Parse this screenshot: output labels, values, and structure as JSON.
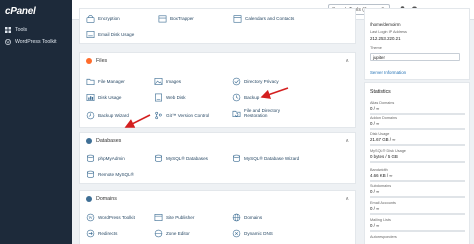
{
  "brand": "cPanel",
  "colors": {
    "sidebar": "#1d2a3a",
    "accent": "#ff6c2c",
    "link": "#1f6fb4",
    "arrow": "#d41f1f"
  },
  "sidebar": {
    "items": [
      {
        "label": "Tools",
        "icon": "grid-icon"
      },
      {
        "label": "WordPress Toolkit",
        "icon": "wordpress-icon"
      }
    ]
  },
  "topbar": {
    "search_placeholder": "Search Tools (/)"
  },
  "top_items": [
    {
      "label": "Encryption",
      "icon": "lock-icon"
    },
    {
      "label": "BoxTrapper",
      "icon": "box-icon"
    },
    {
      "label": "Calendars and Contacts",
      "icon": "calendar-icon"
    },
    {
      "label": "Email Disk Usage",
      "icon": "disk-icon"
    }
  ],
  "files": {
    "title": "Files",
    "items": [
      {
        "label": "File Manager",
        "icon": "file-manager-icon"
      },
      {
        "label": "Images",
        "icon": "images-icon"
      },
      {
        "label": "Directory Privacy",
        "icon": "directory-privacy-icon"
      },
      {
        "label": "Disk Usage",
        "icon": "disk-usage-icon"
      },
      {
        "label": "Web Disk",
        "icon": "web-disk-icon"
      },
      {
        "label": "Backup",
        "icon": "backup-icon"
      },
      {
        "label": "Backup Wizard",
        "icon": "backup-wizard-icon"
      },
      {
        "label": "Git™ Version Control",
        "icon": "git-icon"
      },
      {
        "label": "File and Directory Restoration",
        "icon": "restore-icon"
      }
    ]
  },
  "databases": {
    "title": "Databases",
    "items": [
      {
        "label": "phpMyAdmin",
        "icon": "phpmyadmin-icon"
      },
      {
        "label": "MySQL® Databases",
        "icon": "mysql-icon"
      },
      {
        "label": "MySQL® Database Wizard",
        "icon": "mysql-wizard-icon"
      },
      {
        "label": "Remote MySQL®",
        "icon": "remote-mysql-icon"
      }
    ]
  },
  "domains": {
    "title": "Domains",
    "items": [
      {
        "label": "WordPress Toolkit",
        "icon": "wordpress-icon"
      },
      {
        "label": "Site Publisher",
        "icon": "site-publisher-icon"
      },
      {
        "label": "Domains",
        "icon": "domains-icon"
      },
      {
        "label": "Redirects",
        "icon": "redirects-icon"
      },
      {
        "label": "Zone Editor",
        "icon": "zone-editor-icon"
      },
      {
        "label": "Dynamic DNS",
        "icon": "dynamic-dns-icon"
      }
    ]
  },
  "right": {
    "home_dir": "/home/demoirm",
    "last_login_label": "Last Login IP Address",
    "last_login_ip": "212.253.220.21",
    "theme_label": "Theme",
    "theme_value": "jupiter",
    "server_info": "Server Information",
    "stats_title": "Statistics",
    "stats": [
      {
        "label": "Alias Domains",
        "value": "0 / ∞"
      },
      {
        "label": "Addon Domains",
        "value": "0 / ∞"
      },
      {
        "label": "Disk Usage",
        "value": "21.67 GB / ∞"
      },
      {
        "label": "MySQL® Disk Usage",
        "value": "0 bytes / 5 GB"
      },
      {
        "label": "Bandwidth",
        "value": "4.66 KB / ∞"
      },
      {
        "label": "Subdomains",
        "value": "0 / ∞"
      },
      {
        "label": "Email Accounts",
        "value": "0 / ∞"
      },
      {
        "label": "Mailing Lists",
        "value": "0 / ∞"
      },
      {
        "label": "Autoresponders",
        "value": ""
      }
    ]
  }
}
